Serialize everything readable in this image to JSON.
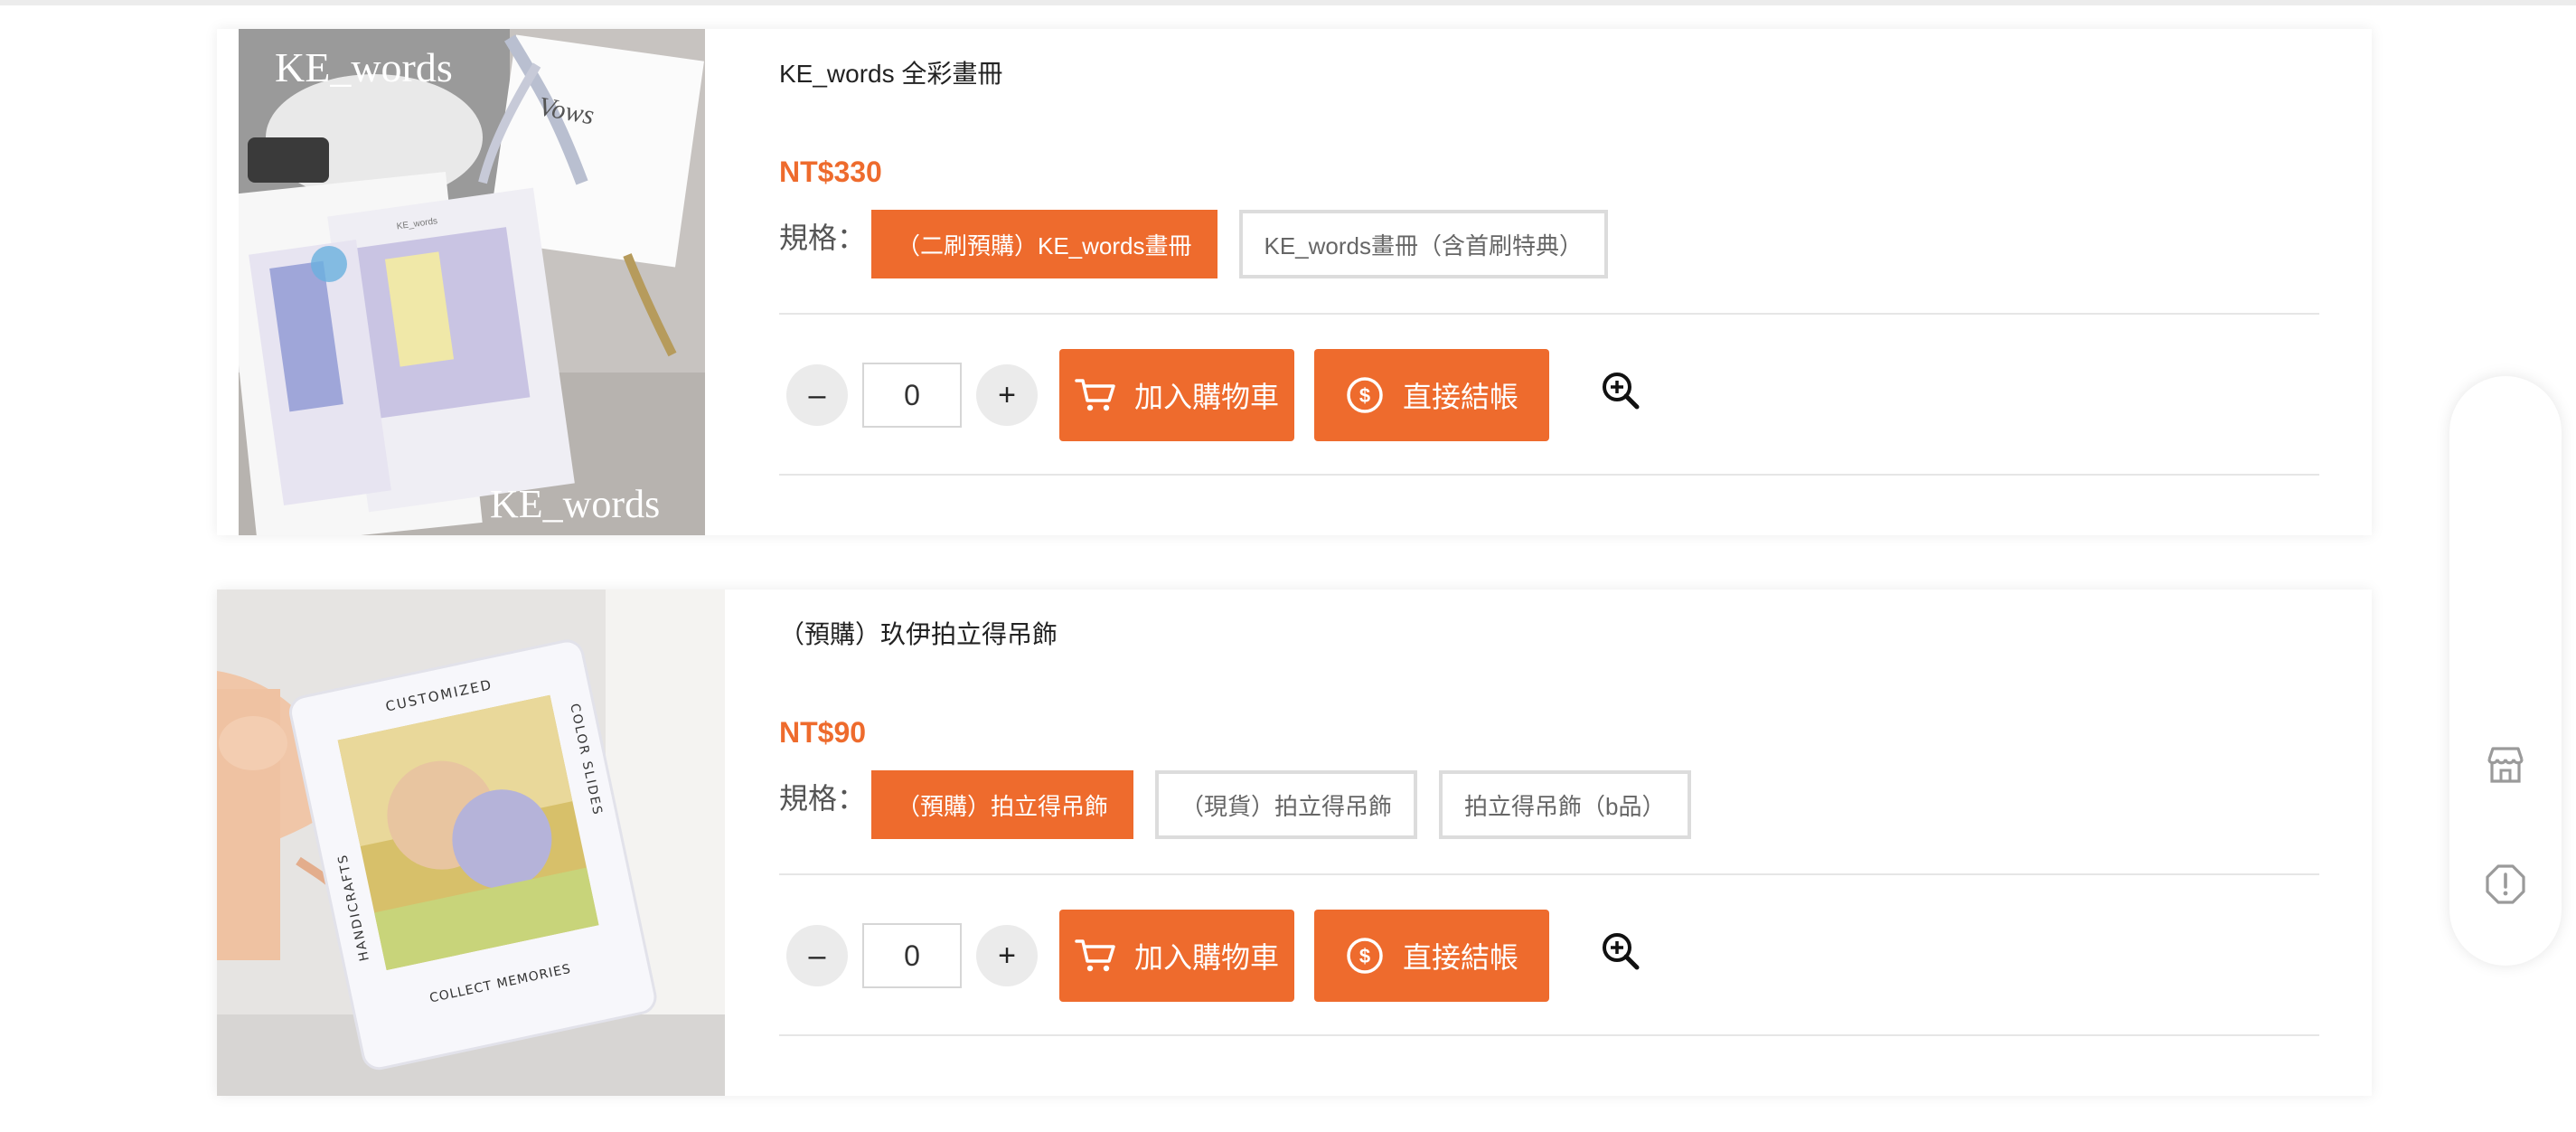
{
  "products": [
    {
      "title": "KE_words 全彩畫冊",
      "price": "NT$330",
      "spec_label": "規格：",
      "options": [
        "（二刷預購）KE_words畫冊",
        "KE_words畫冊（含首刷特典）"
      ],
      "selected_option": 0,
      "quantity": "0",
      "minus_label": "–",
      "plus_label": "+",
      "add_to_cart_label": "加入購物車",
      "checkout_label": "直接結帳",
      "image_text": {
        "top": "KE_words",
        "bottom": "KE_words",
        "side": "Vows",
        "cover": "KE_words"
      }
    },
    {
      "title": "（預購）玖伊拍立得吊飾",
      "price": "NT$90",
      "spec_label": "規格：",
      "options": [
        "（預購）拍立得吊飾",
        "（現貨）拍立得吊飾",
        "拍立得吊飾（b品）"
      ],
      "selected_option": 0,
      "quantity": "0",
      "minus_label": "–",
      "plus_label": "+",
      "add_to_cart_label": "加入購物車",
      "checkout_label": "直接結帳",
      "image_text": {
        "top": "CUSTOMIZED",
        "bottom": "COLLECT MEMORIES",
        "left": "HANDICRAFTS",
        "right": "COLOR SLIDES"
      }
    }
  ],
  "floating_bar": {
    "icons": [
      "store-icon",
      "alert-icon"
    ]
  },
  "colors": {
    "accent": "#ee6b2d",
    "border": "#dcdcdc",
    "divider": "#e6e6e6"
  }
}
